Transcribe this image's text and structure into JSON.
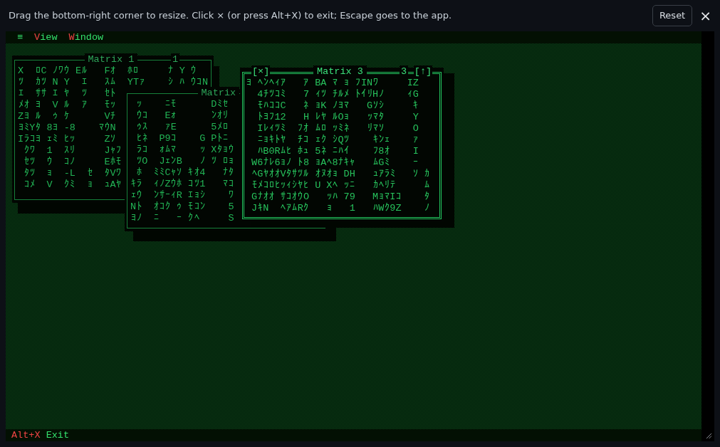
{
  "hint": "Drag the bottom-right corner to resize. Click × (or press Alt+X) to exit; Escape goes to the app.",
  "reset_button": "Reset",
  "close_button": "×",
  "menu": {
    "icon": "≡",
    "items": [
      {
        "label": "View"
      },
      {
        "label": "Window"
      }
    ]
  },
  "windows": [
    {
      "title": "Matrix 1",
      "number": "1",
      "active": false,
      "lines": [
        "X  ﾛC ﾉﾜｳ Eﾙ   Fｵ  ﾎﾛ     ﾅ Y ｳ",
        "ﾂ  ｶﾂ N Y  ｴ   ｽﾑ  YTｧ    ｼ ﾊ ｳｺN",
        "ｴ  ｻｻ ｴ ﾔ  ﾂ   ｾﾄ",
        "ﾒｵ ﾖ  V ﾙ  ｱ   ﾓｯ",
        "Zﾖ ﾙ  ｩ ｹ      Vﾁ",
        "ﾖﾐYﾀ 8ﾖ -8    ﾏｳN",
        "Iﾗｺﾖ ｪﾐ ﾋｯ     Zｿ",
        " ｸﾜ  1  ｽﾘ     Jｬﾌ",
        " ｾﾂ  ｳ  ｺﾉ     Eﾎﾓ",
        " ﾀﾂ  ｮ  -L  ｾ  ﾀVﾜ",
        " ｺﾒ  V  ｸﾐ  ｮ  ｭAﾔ"
      ]
    },
    {
      "title": "Matrix",
      "active": false,
      "lines": [
        " ｯ    ﾆﾓ      Dﾐｾ",
        " ｳｺ   Eｫ      ﾝｵﾘ",
        " ｩｽ   ｧE      5ﾒﾛ",
        " ﾋﾈ  P9ｺ    G Pﾄﾆ",
        " ﾗｺ  ｫﾑﾏ    ｯ Xﾀｮｳ",
        " ﾂO  JｪﾝB   ﾉ ﾂ ﾛｮ",
        " ﾎ  ﾐﾐCｬｿ ｷｵ4   ﾅﾀ",
        "ｷﾗ  ｨﾉZｳﾎ ｺﾂ1   ﾏｺ",
        "ｪｳ  ﾝｻｰｨR ｴｮｼ    ﾜ",
        "Nﾄ  ｵｺｸ ｩ ﾓｺﾝ    5",
        "ﾖﾉ  ﾆ   ｰ ｸﾍ     S"
      ]
    },
    {
      "title": "Matrix 3",
      "number": "3",
      "active": true,
      "close": "[×]",
      "maximize": "[↑]",
      "lines": [
        "ﾖ ﾍﾝﾍｨｱ   ｱ BA ﾏ ｮ ﾌINﾜ     IZ",
        "  4ﾁﾂｺﾐ   7 ｨﾂ ﾁﾙﾒ ﾄｲﾘHﾉ    ｨG",
        "  ﾓﾊｺｺC   ﾈ ｮK ﾉﾖﾏ   Gｿｼ     ｷ",
        "  ﾄﾖﾌ12   H ﾚﾔ ﾙOｮ   ｯﾏﾀ     Y",
        "  Iﾚｨﾂﾐ  ﾌｵ ﾑﾛ ｯﾐﾈ   ﾘﾏｿ     O",
        "  ﾆｮｷﾄﾔ  ﾁｺ ｪｸ ｼQﾂ    ｷﾝｪ    ｧ",
        "  ﾊB0Rﾑﾋ ﾎｭ 5ﾈ ﾆﾊｲ    ﾌ8ｵ    I",
        " W6ﾅﾚ6ｮﾉ ﾄ8 ｮAﾍ8ﾅｷｬ   ﾑGﾐ    ｰ",
        " ﾍGﾔｵｵVﾀｻﾂﾙ ｵﾇｵｮ DH   ｭｱﾗﾐ   ｿ ｶ",
        " ﾓﾒｺﾛﾋｯｨｼﾔﾋ U Xﾍ ｯﾆ   ｶﾍﾘﾃ     ﾑ",
        " Gﾅｵｵ ｻｺｵｳO   ｯﾊ 79   MｮﾏIｺ    ﾀ",
        " JｷN  ﾍｱﾑRｸ   ｮ   1   ﾊWｸ9Z    ﾉ"
      ]
    }
  ],
  "status_bar": [
    {
      "key": "Alt+X",
      "label": "Exit"
    }
  ]
}
